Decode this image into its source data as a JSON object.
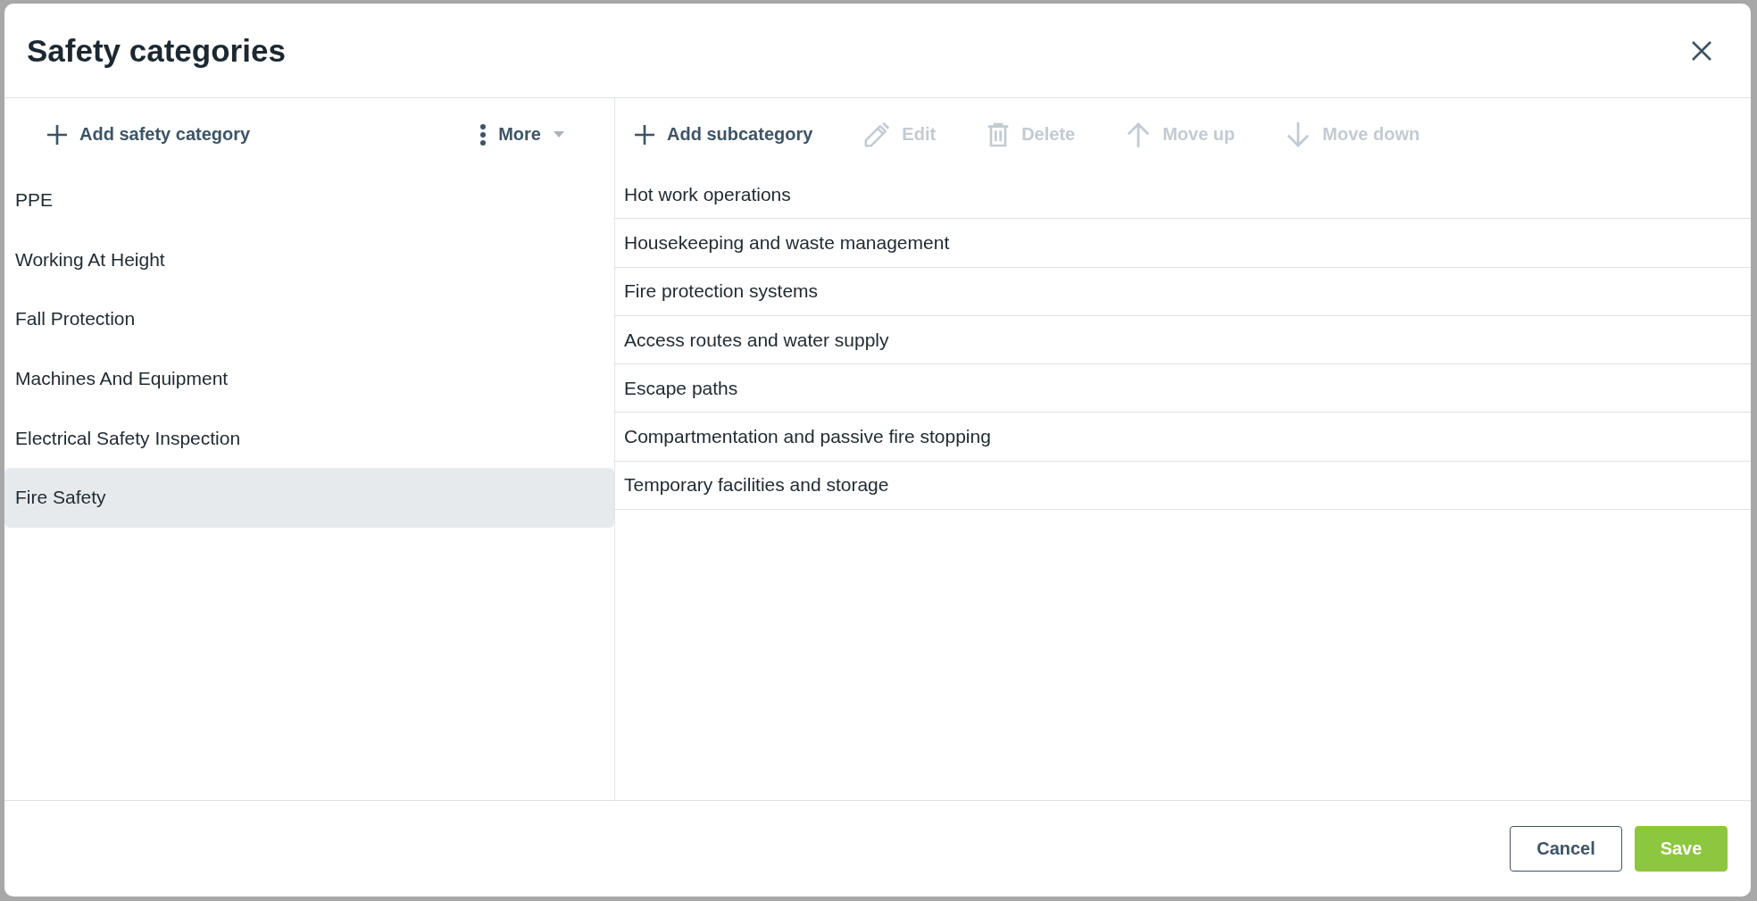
{
  "dialog": {
    "title": "Safety categories"
  },
  "categories_panel": {
    "toolbar": [
      {
        "kind": "add",
        "label": "Add safety category"
      },
      {
        "kind": "more",
        "label": "More"
      }
    ],
    "items": [
      {
        "label": "PPE",
        "selected": false
      },
      {
        "label": "Working At Height",
        "selected": false
      },
      {
        "label": "Fall Protection",
        "selected": false
      },
      {
        "label": "Machines And Equipment",
        "selected": false
      },
      {
        "label": "Electrical Safety Inspection",
        "selected": false
      },
      {
        "label": "Fire Safety",
        "selected": true
      }
    ]
  },
  "subcategories_panel": {
    "toolbar": [
      {
        "kind": "add",
        "label": "Add subcategory",
        "disabled": false
      },
      {
        "kind": "edit",
        "label": "Edit",
        "disabled": true
      },
      {
        "kind": "delete",
        "label": "Delete",
        "disabled": true
      },
      {
        "kind": "move_up",
        "label": "Move up",
        "disabled": true
      },
      {
        "kind": "move_down",
        "label": "Move down",
        "disabled": true
      }
    ],
    "rows": [
      "Hot work operations",
      "Housekeeping and waste management",
      "Fire protection systems",
      "Access routes and water supply",
      "Escape paths",
      "Compartmentation and passive fire stopping",
      "Temporary facilities and storage"
    ]
  },
  "footer": {
    "buttons": [
      {
        "kind": "secondary",
        "label": "Cancel"
      },
      {
        "kind": "primary",
        "label": "Save"
      }
    ]
  }
}
